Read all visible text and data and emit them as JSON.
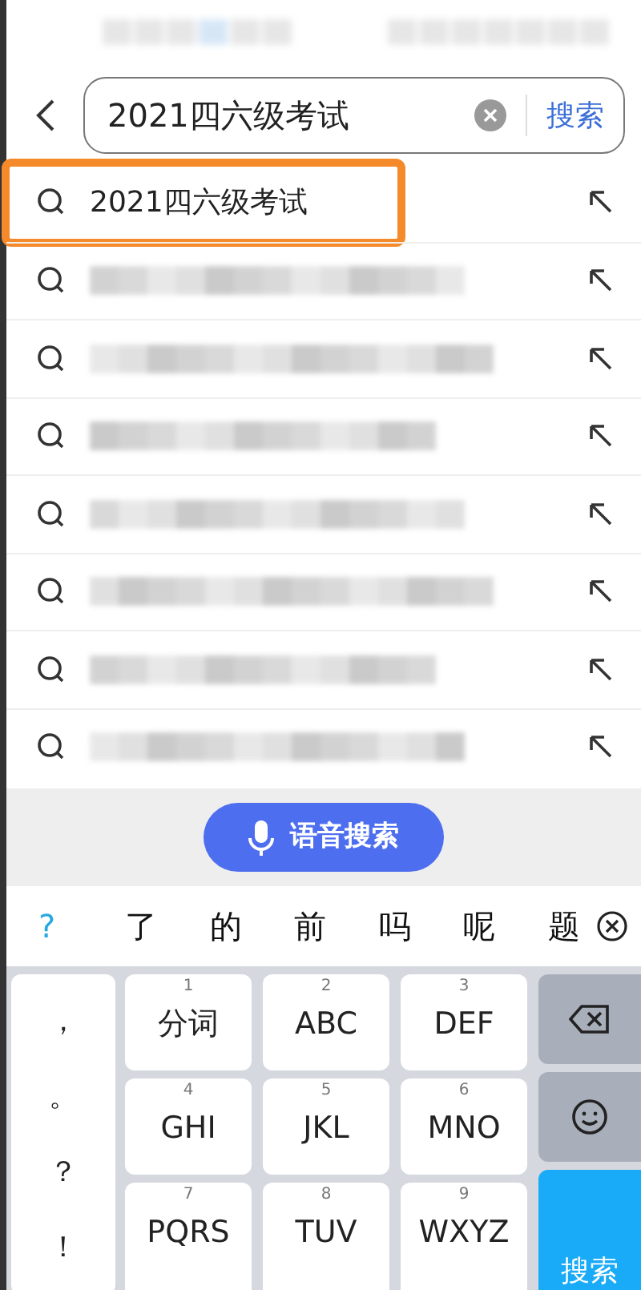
{
  "search_bar": {
    "value": "2021四六级考试",
    "submit": "搜索"
  },
  "suggestions": [
    {
      "kind": "query",
      "text": "2021四六级考试",
      "highlighted": true
    },
    {
      "kind": "blurred",
      "highlighted": false
    },
    {
      "kind": "blurred",
      "highlighted": false
    },
    {
      "kind": "blurred",
      "highlighted": false
    },
    {
      "kind": "blurred",
      "highlighted": false
    },
    {
      "kind": "blurred",
      "highlighted": false
    },
    {
      "kind": "blurred",
      "highlighted": false
    },
    {
      "kind": "blurred",
      "highlighted": false
    }
  ],
  "voice_button": "语音搜索",
  "candidates": {
    "help": "?",
    "words": [
      "了",
      "的",
      "前",
      "吗",
      "呢",
      "题"
    ]
  },
  "keyboard": {
    "punctuation": [
      "，",
      "。",
      "？",
      "！"
    ],
    "keys": [
      {
        "number": "1",
        "label": "分词"
      },
      {
        "number": "2",
        "label": "ABC"
      },
      {
        "number": "3",
        "label": "DEF"
      },
      {
        "number": "4",
        "label": "GHI"
      },
      {
        "number": "5",
        "label": "JKL"
      },
      {
        "number": "6",
        "label": "MNO"
      },
      {
        "number": "7",
        "label": "PQRS"
      },
      {
        "number": "8",
        "label": "TUV"
      },
      {
        "number": "9",
        "label": "WXYZ"
      }
    ],
    "side_keys": [
      {
        "kind": "backspace"
      },
      {
        "kind": "emoji"
      },
      {
        "kind": "search",
        "label": "搜索"
      }
    ]
  }
}
